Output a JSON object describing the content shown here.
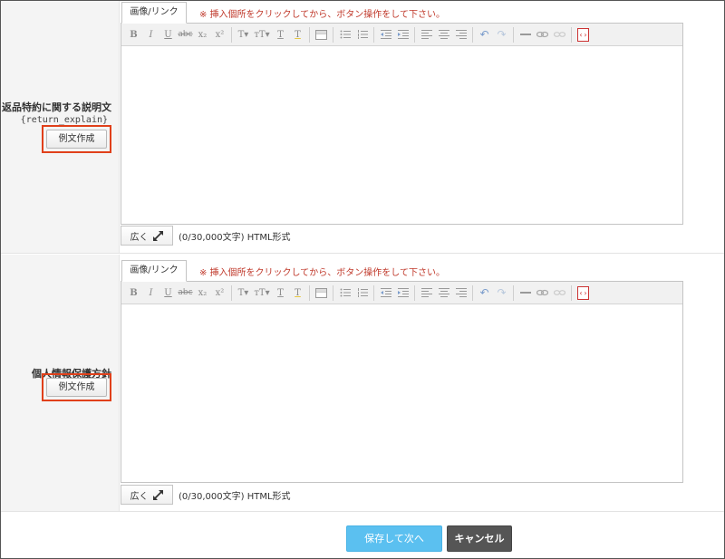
{
  "fields": [
    {
      "label": "返品特約に関する説明文",
      "code": "{return_explain}",
      "example_button": "例文作成",
      "image_tab": "画像/リンク",
      "notice": "※ 挿入個所をクリックしてから、ボタン操作をして下さい。",
      "expand_label": "広く",
      "counter": "(0/30,000文字) HTML形式"
    },
    {
      "label": "個人情報保護方針",
      "code": "",
      "example_button": "例文作成",
      "image_tab": "画像/リンク",
      "notice": "※ 挿入個所をクリックしてから、ボタン操作をして下さい。",
      "expand_label": "広く",
      "counter": "(0/30,000文字) HTML形式"
    }
  ],
  "toolbar": {
    "bold": "B",
    "italic": "I",
    "underline": "U",
    "strike": "abc",
    "subscript": "x₂",
    "superscript": "x²",
    "font_size": "T▾",
    "font_size_b": "тT▾",
    "text_color": "T",
    "bg_color": "T",
    "source": "‹›"
  },
  "actions": {
    "save_next": "保存して次へ",
    "cancel": "キャンセル"
  },
  "colors": {
    "highlight_border": "#e0401a",
    "save_button": "#5bc0f0",
    "cancel_button": "#555555",
    "notice_text": "#c0392b"
  }
}
